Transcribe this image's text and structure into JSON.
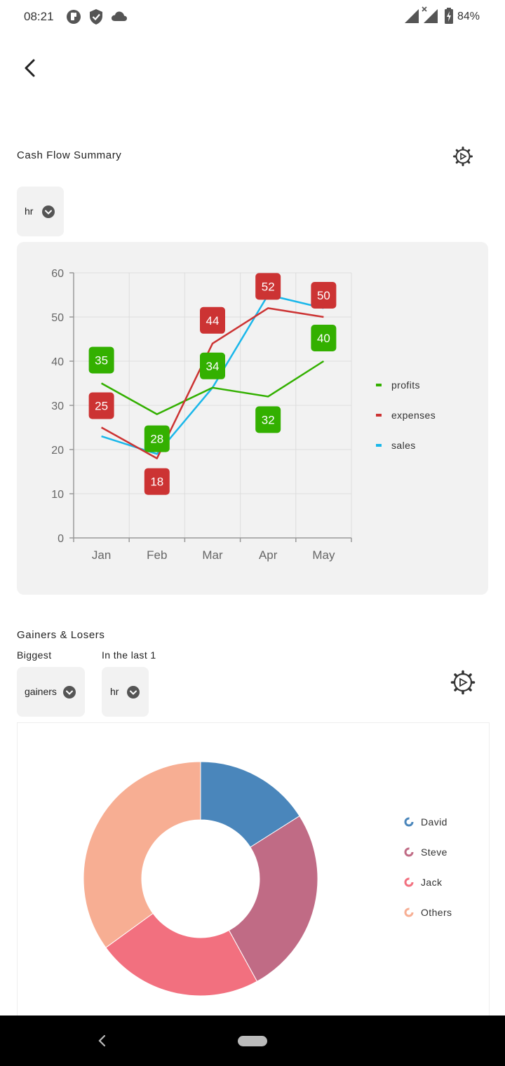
{
  "status": {
    "time": "08:21",
    "battery": "84%",
    "icons": [
      "app-notification-icon",
      "shield-icon",
      "cloud-icon",
      "signal-icon",
      "signal-no-data-icon",
      "battery-charging-icon"
    ]
  },
  "cashflow": {
    "title": "Cash Flow Summary",
    "dropdown_value": "hr"
  },
  "chart_data": [
    {
      "type": "line",
      "categories": [
        "Jan",
        "Feb",
        "Mar",
        "Apr",
        "May"
      ],
      "ylim": [
        0,
        60
      ],
      "yticks": [
        "0",
        "10",
        "20",
        "30",
        "40",
        "50",
        "60"
      ],
      "grid": true,
      "legend_position": "right",
      "series": [
        {
          "name": "profits",
          "color": "#33b000",
          "values": [
            35,
            28,
            34,
            32,
            40
          ],
          "labels": [
            "35",
            "28",
            "34",
            "32",
            "40"
          ]
        },
        {
          "name": "expenses",
          "color": "#cc3333",
          "values": [
            25,
            18,
            44,
            52,
            50
          ],
          "labels": [
            "25",
            "18",
            "44",
            "52",
            "50"
          ]
        },
        {
          "name": "sales",
          "color": "#1ab7ea",
          "values": [
            23,
            19,
            34,
            55,
            52
          ],
          "labels": []
        }
      ]
    },
    {
      "type": "pie",
      "donut": true,
      "legend_position": "right",
      "slices": [
        {
          "name": "David",
          "value": 16,
          "color": "#4a86bb"
        },
        {
          "name": "Steve",
          "value": 26,
          "color": "#c06b85"
        },
        {
          "name": "Jack",
          "value": 23,
          "color": "#f2707f"
        },
        {
          "name": "Others",
          "value": 35,
          "color": "#f7ae93"
        }
      ]
    }
  ],
  "gainers": {
    "title": "Gainers & Losers",
    "biggest_label": "Biggest",
    "last_label": "In the last 1",
    "type_value": "gainers",
    "period_value": "hr"
  }
}
